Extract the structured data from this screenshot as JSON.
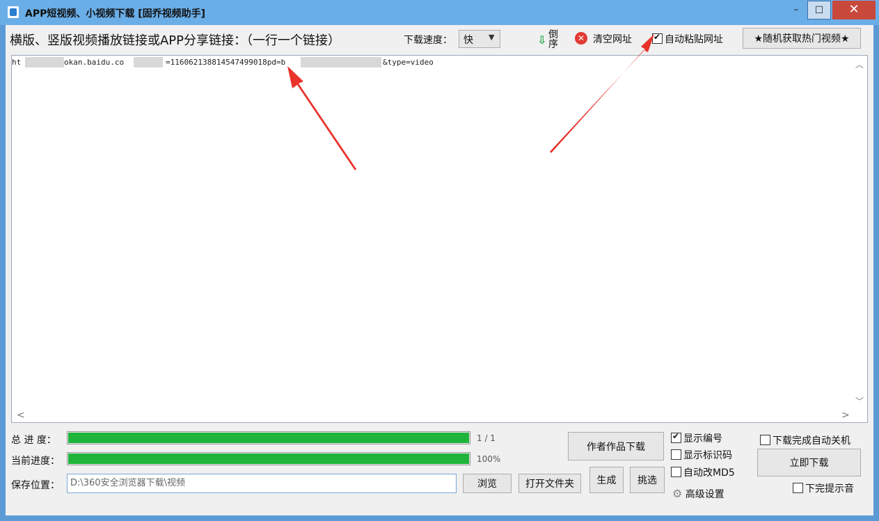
{
  "window": {
    "title": "APP短视频、小视频下载 [固乔视频助手]",
    "min_symbol": "–",
    "max_symbol": "☐",
    "close_symbol": "✕"
  },
  "toolbar": {
    "instruction": "横版、竖版视频播放链接或APP分享链接：（一行一个链接）",
    "speed_label": "下载速度：",
    "speed_value": "快",
    "reverse_label_1": "倒",
    "reverse_label_2": "序",
    "clear_label": "清空网址",
    "auto_paste_label": "自动粘贴网址",
    "random_hot_label": "★随机获取热门视频★"
  },
  "editor": {
    "line_1": {
      "part_a": "ht",
      "part_b": "okan.baidu.co",
      "part_c": "=116062138814547499018pd=b",
      "part_d": "&type=video"
    }
  },
  "progress": {
    "total_label": "总 进 度：",
    "current_label": "当前进度：",
    "total_text": "1 / 1",
    "current_text": "100%",
    "total_fraction": 1.0,
    "current_fraction": 1.0
  },
  "save": {
    "label": "保存位置：",
    "path": "D:\\360安全浏览器下载\\视频"
  },
  "buttons": {
    "browse": "浏览",
    "open_folder": "打开文件夹",
    "author_download": "作者作品下载",
    "generate": "生成",
    "pick": "挑选",
    "download_now": "立即下载"
  },
  "options": {
    "show_number": "显示编号",
    "show_id": "显示标识码",
    "auto_md5": "自动改MD5",
    "advanced": "高级设置",
    "shutdown": "下载完成自动关机",
    "sound": "下完提示音"
  },
  "colors": {
    "progress_fill": "#1fb53a",
    "annotation_arrow": "#e8322a"
  }
}
